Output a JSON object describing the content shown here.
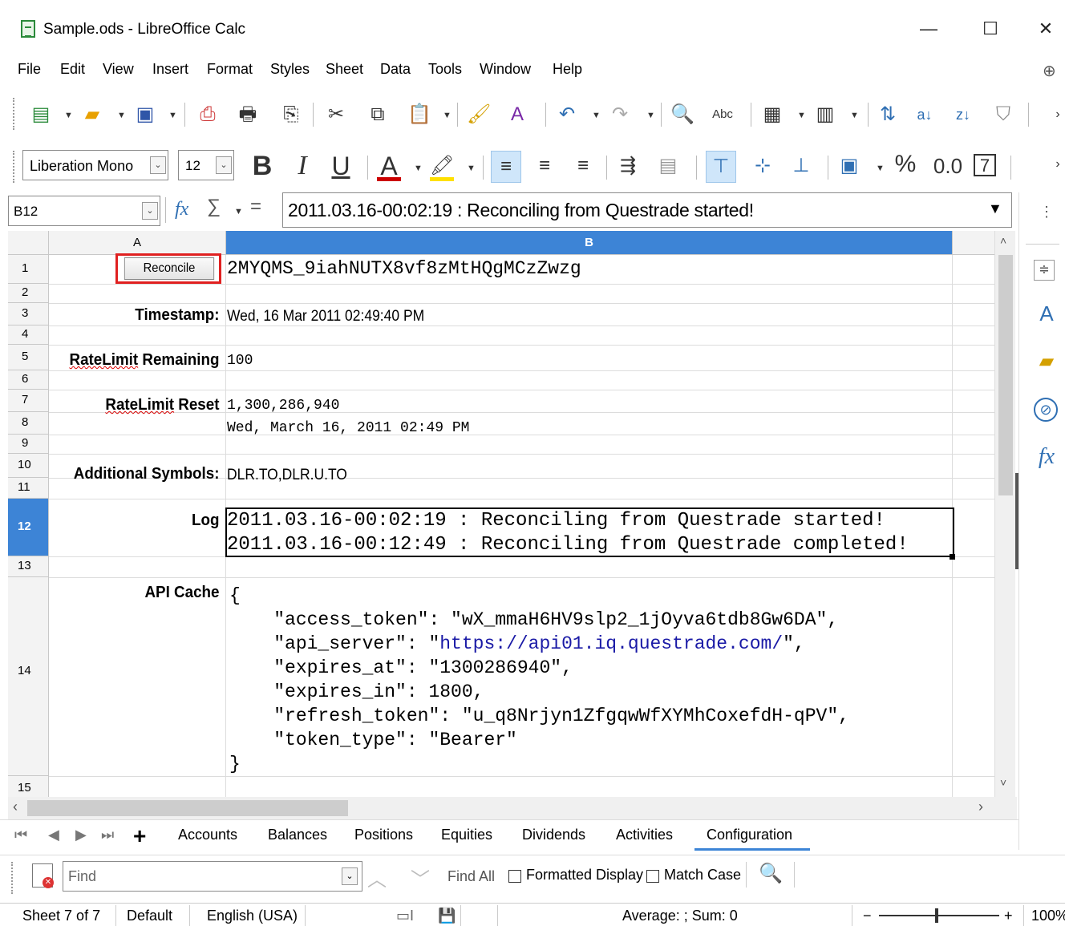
{
  "window": {
    "title": "Sample.ods - LibreOffice Calc",
    "minimize": "—",
    "maximize": "☐",
    "close": "✕"
  },
  "menu": [
    "File",
    "Edit",
    "View",
    "Insert",
    "Format",
    "Styles",
    "Sheet",
    "Data",
    "Tools",
    "Window",
    "Help"
  ],
  "formatting": {
    "font_name": "Liberation Mono",
    "font_size": "12",
    "number_format_pct": "%",
    "number_format_dec": "0.0",
    "number_format_7": "7"
  },
  "formula_bar": {
    "name_box": "B12",
    "fx": "fx",
    "sum": "∑",
    "equals": "=",
    "content": "2011.03.16-00:02:19 : Reconciling from Questrade started!"
  },
  "grid": {
    "columns": [
      "A",
      "B"
    ],
    "selected_column": "B",
    "rows": [
      "1",
      "2",
      "3",
      "4",
      "5",
      "6",
      "7",
      "8",
      "9",
      "10",
      "11",
      "12",
      "13",
      "14",
      "15"
    ],
    "selected_row": "12",
    "reconcile_button": "Reconcile",
    "cells": {
      "B1": "2MYQMS_9iahNUTX8vf8zMtHQgMCzZwzg",
      "A3": "Timestamp:",
      "B3": "Wed, 16 Mar 2011 02:49:40 PM",
      "A5_part1": "RateLimit",
      "A5_part2": " Remaining",
      "B5": "100",
      "A7_part1": "RateLimit",
      "A7_part2": " Reset",
      "B7": "1,300,286,940",
      "B8": "Wed, March 16, 2011 02:49 PM",
      "A10": "Additional Symbols:",
      "B10": "DLR.TO,DLR.U.TO",
      "A12": "Log",
      "B12_line1": "2011.03.16-00:02:19 : Reconciling from Questrade started!",
      "B12_line2": "2011.03.16-00:12:49 : Reconciling from Questrade completed!",
      "A14": "API Cache",
      "B14_lines": [
        "{",
        "    \"access_token\": \"wX_mmaH6HV9slp2_1jOyva6tdb8Gw6DA\",",
        "    \"api_server\": \"https://api01.iq.questrade.com/\",",
        "    \"expires_at\": \"1300286940\",",
        "    \"expires_in\": 1800,",
        "    \"refresh_token\": \"u_q8Nrjyn1ZfgqwWfXYMhCoxefdH-qPV\",",
        "    \"token_type\": \"Bearer\"",
        "}"
      ]
    }
  },
  "sheet_tabs": [
    "Accounts",
    "Balances",
    "Positions",
    "Equities",
    "Dividends",
    "Activities",
    "Configuration"
  ],
  "active_sheet": "Configuration",
  "add_sheet": "+",
  "find_bar": {
    "placeholder": "Find",
    "find_all": "Find All",
    "formatted_display": "Formatted Display",
    "match_case": "Match Case"
  },
  "status_bar": {
    "sheet": "Sheet 7 of 7",
    "page_style": "Default",
    "language": "English (USA)",
    "summary": "Average: ; Sum: 0",
    "zoom": "100%",
    "zoom_minus": "−",
    "zoom_plus": "+"
  },
  "colors": {
    "selection_header": "#3d84d6",
    "highlight_box": "#e02020",
    "link": "#1a1aa6"
  }
}
